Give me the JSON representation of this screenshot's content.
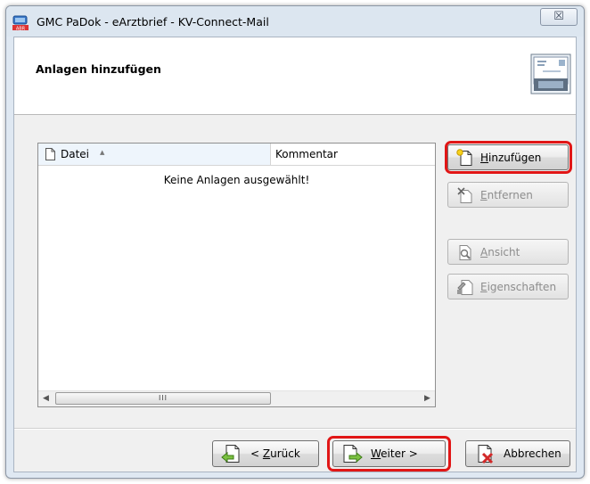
{
  "window": {
    "title": "GMC PaDok  -  eArztbrief  -  KV-Connect-Mail",
    "close_label": "☒"
  },
  "header": {
    "title": "Anlagen hinzufügen"
  },
  "list": {
    "columns": [
      {
        "label": "Datei",
        "sort_indicator": "▲"
      },
      {
        "label": "Kommentar"
      }
    ],
    "empty_message": "Keine Anlagen ausgewählt!",
    "scroll": {
      "left": "◀",
      "right": "▶",
      "thumb": "III"
    }
  },
  "side_buttons": {
    "hinzufuegen": {
      "mnemonic": "H",
      "rest": "inzufügen",
      "enabled": true,
      "highlighted": true
    },
    "entfernen": {
      "mnemonic": "E",
      "rest": "ntfernen",
      "enabled": false
    },
    "ansicht": {
      "mnemonic": "A",
      "rest": "nsicht",
      "enabled": false
    },
    "eigenschaften": {
      "mnemonic": "E",
      "rest": "igenschaften",
      "enabled": false
    }
  },
  "nav_buttons": {
    "zurueck": {
      "prefix": "< ",
      "mnemonic": "Z",
      "rest": "urück"
    },
    "weiter": {
      "mnemonic": "W",
      "rest": "eiter >",
      "highlighted": true
    },
    "abbrechen": {
      "label": "Abbrechen"
    }
  },
  "colors": {
    "highlight": "#e11616",
    "title_bg": "#dce6f0",
    "dialog_bg": "#f0f0f0"
  }
}
